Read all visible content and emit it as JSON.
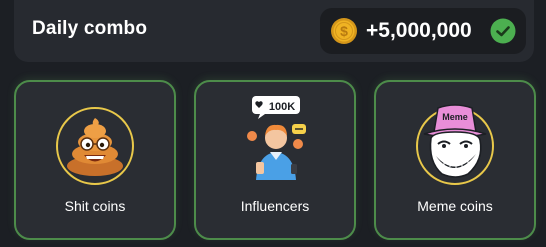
{
  "header": {
    "title": "Daily combo",
    "reward_amount": "+5,000,000",
    "coin_icon": "gold-dollar-coin-icon",
    "status_icon": "green-check-icon"
  },
  "cards": [
    {
      "label": "Shit coins",
      "icon": "poop-emoji-icon"
    },
    {
      "label": "Influencers",
      "icon": "influencer-avatar-icon",
      "badge_text": "100K"
    },
    {
      "label": "Meme coins",
      "icon": "trollface-meme-icon",
      "badge_text": "Meme"
    }
  ],
  "colors": {
    "background": "#1c1f24",
    "header_bg": "#272a30",
    "card_bg": "#2a2d33",
    "card_border": "#4d8c4a",
    "check_green": "#4caf50",
    "coin_gold": "#f0b323"
  }
}
